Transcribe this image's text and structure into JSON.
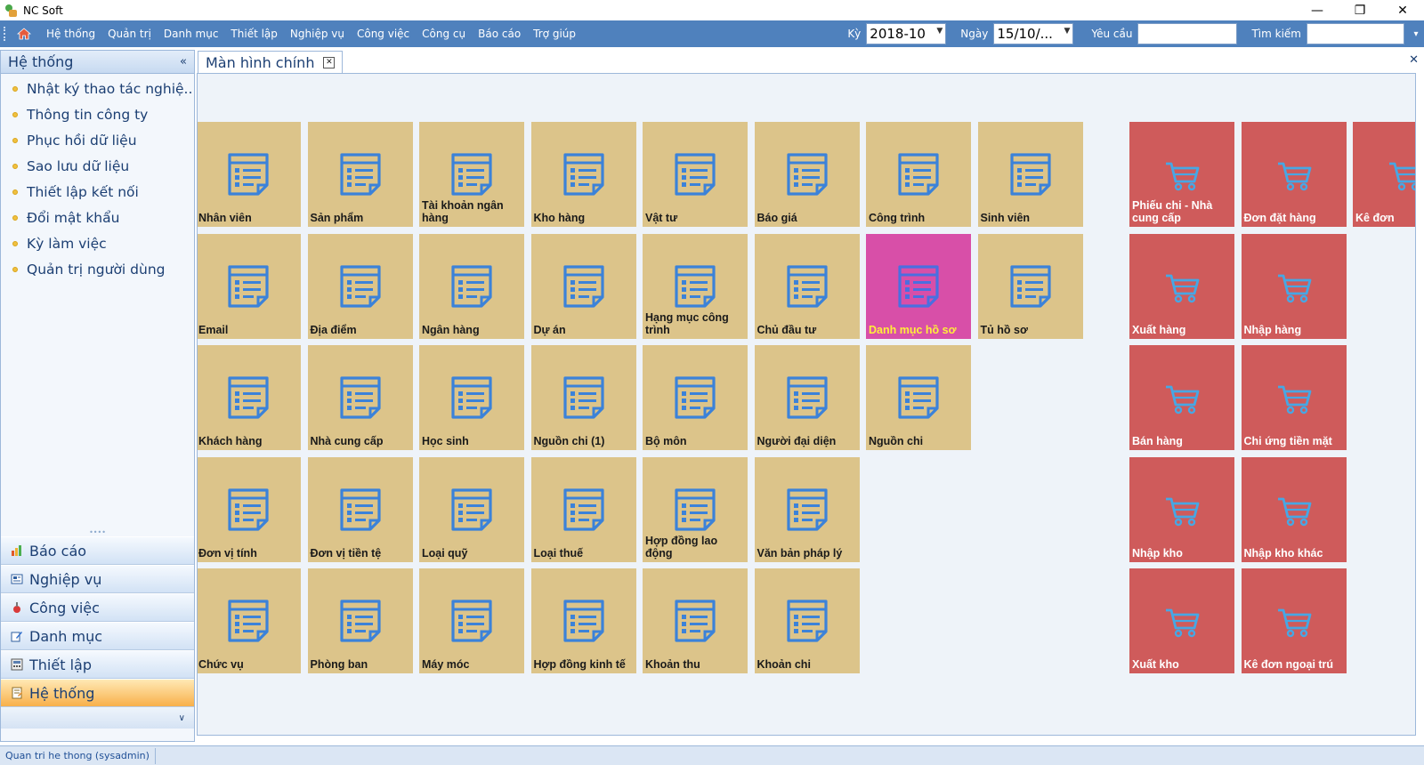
{
  "window": {
    "title": "NC Soft"
  },
  "menu": {
    "items": [
      "Hệ thống",
      "Quản trị",
      "Danh mục",
      "Thiết lập",
      "Nghiệp vụ",
      "Công việc",
      "Công cụ",
      "Báo cáo",
      "Trợ giúp"
    ],
    "ky_label": "Kỳ",
    "ky_value": "2018-10",
    "ngay_label": "Ngày",
    "ngay_value": "15/10/...",
    "yeucau_label": "Yêu cầu",
    "yeucau_value": "",
    "timkiem_label": "Tìm kiếm",
    "timkiem_value": ""
  },
  "sidebar": {
    "title": "Hệ thống",
    "items": [
      "Nhật ký thao tác nghiệ...",
      "Thông tin công ty",
      "Phục hồi dữ liệu",
      "Sao lưu dữ liệu",
      "Thiết lập kết nối",
      "Đổi mật khẩu",
      "Kỳ làm việc",
      "Quản trị người dùng"
    ],
    "groups": [
      {
        "label": "Báo cáo",
        "icon": "chart-icon"
      },
      {
        "label": "Nghiệp vụ",
        "icon": "form-icon"
      },
      {
        "label": "Công việc",
        "icon": "task-icon"
      },
      {
        "label": "Danh mục",
        "icon": "edit-icon"
      },
      {
        "label": "Thiết lập",
        "icon": "calculator-icon"
      },
      {
        "label": "Hệ thống",
        "icon": "note-icon",
        "active": true
      }
    ]
  },
  "tabs": [
    {
      "label": "Màn hình chính"
    }
  ],
  "tiles": [
    [
      "Nhân viên",
      "Sản phẩm",
      "Tài khoản ngân hàng",
      "Kho hàng",
      "Vật tư",
      "Báo giá",
      "Công trình",
      "Sinh viên"
    ],
    [
      "Email",
      "Địa điểm",
      "Ngân hàng",
      "Dự án",
      "Hạng mục công trình",
      "Chủ đầu tư",
      "Danh mục hồ sơ",
      "Tủ hồ sơ"
    ],
    [
      "Khách hàng",
      "Nhà cung cấp",
      "Học sinh",
      "Nguồn chi (1)",
      "Bộ môn",
      "Người đại diện",
      "Nguồn chi"
    ],
    [
      "Đơn vị tính",
      "Đơn vị tiền tệ",
      "Loại quỹ",
      "Loại thuế",
      "Hợp đồng lao động",
      "Văn bản pháp lý"
    ],
    [
      "Chức vụ",
      "Phòng ban",
      "Máy móc",
      "Hợp đồng kinh tế",
      "Khoản thu",
      "Khoản chi"
    ]
  ],
  "highlighted_tile": "Danh mục hồ sơ",
  "order_tiles": [
    [
      "Phiếu chi - Nhà cung cấp",
      "Đơn đặt hàng",
      "Kê đơn"
    ],
    [
      "Xuất hàng",
      "Nhập hàng"
    ],
    [
      "Bán hàng",
      "Chi ứng tiền mặt"
    ],
    [
      "Nhập kho",
      "Nhập kho khác"
    ],
    [
      "Xuất kho",
      "Kê đơn ngoại trú"
    ]
  ],
  "status": {
    "user": "Quan tri he thong (sysadmin)"
  },
  "colors": {
    "menubar": "#4f81bd",
    "tile_catalog": "#dcc48a",
    "tile_order": "#cf5b5b",
    "tile_highlight": "#d84fa8",
    "tile_icon": "#3b82d9"
  }
}
